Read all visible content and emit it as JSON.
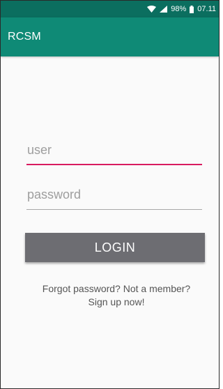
{
  "status_bar": {
    "battery": "98%",
    "time": "07.11",
    "icons": [
      "wifi-icon",
      "cell-signal-icon",
      "battery-icon"
    ]
  },
  "app_bar": {
    "title": "RCSM"
  },
  "login_form": {
    "user_placeholder": "user",
    "user_value": "",
    "password_placeholder": "password",
    "password_value": "",
    "login_label": "LOGIN",
    "signup_text": "Forgot password? Not a member? Sign up now!"
  },
  "colors": {
    "status_bar": "#0b6e5f",
    "app_bar": "#0f8a76",
    "focus_underline": "#d81b60",
    "button": "#6d6d72"
  }
}
